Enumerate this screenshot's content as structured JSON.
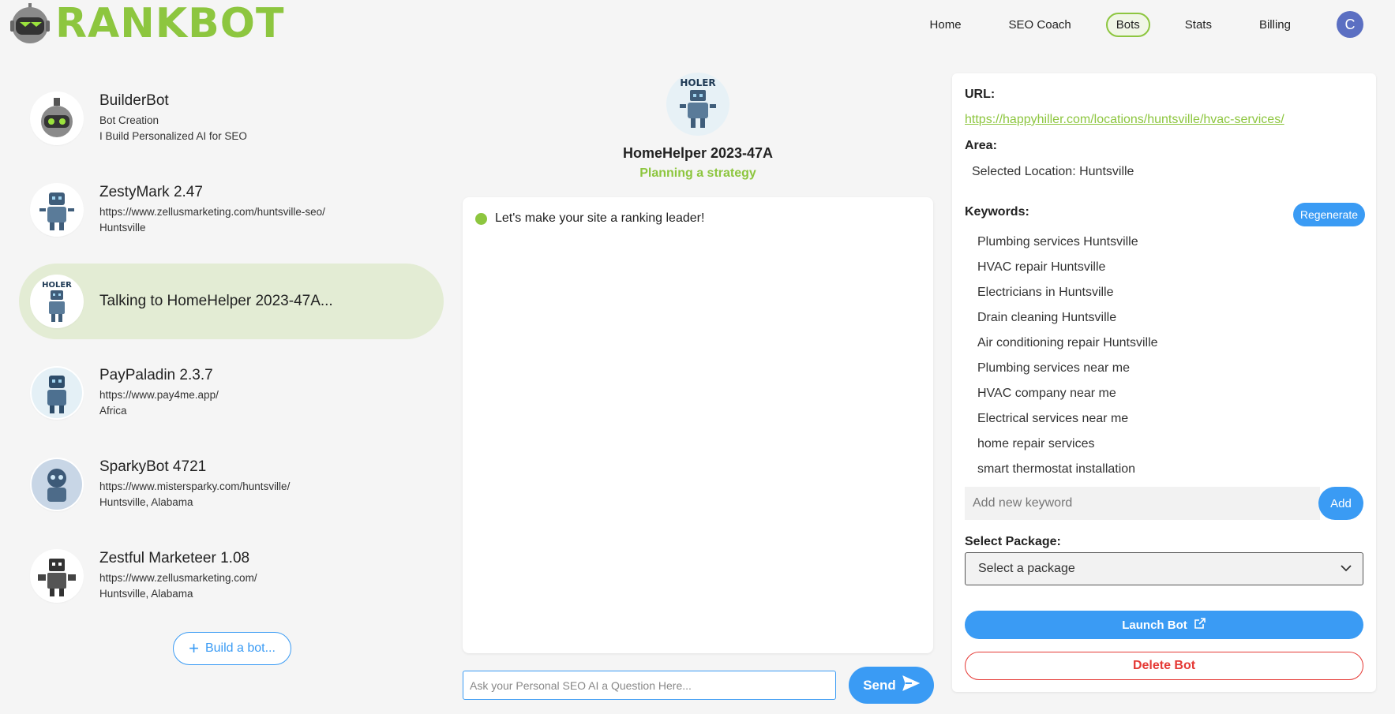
{
  "brand": {
    "name": "RANKBOT",
    "color": "#8dc63f"
  },
  "nav": {
    "items": [
      {
        "label": "Home",
        "active": false
      },
      {
        "label": "SEO Coach",
        "active": false
      },
      {
        "label": "Bots",
        "active": true
      },
      {
        "label": "Stats",
        "active": false
      },
      {
        "label": "Billing",
        "active": false
      }
    ],
    "avatar_initial": "C"
  },
  "bots": [
    {
      "name": "BuilderBot",
      "line1": "Bot Creation",
      "line2": "I Build Personalized AI for SEO",
      "icon": "builder-robot-icon"
    },
    {
      "name": "ZestyMark 2.47",
      "line1": "https://www.zellusmarketing.com/huntsville-seo/",
      "line2": "Huntsville",
      "icon": "robot-icon"
    },
    {
      "name": "Talking to HomeHelper 2023-47A...",
      "active": true,
      "icon": "homehelper-robot-icon"
    },
    {
      "name": "PayPaladin 2.3.7",
      "line1": "https://www.pay4me.app/",
      "line2": "Africa",
      "icon": "robot-icon"
    },
    {
      "name": "SparkyBot 4721",
      "line1": "https://www.mistersparky.com/huntsville/",
      "line2": "Huntsville, Alabama",
      "icon": "robot-icon"
    },
    {
      "name": "Zestful Marketeer 1.08",
      "line1": "https://www.zellusmarketing.com/",
      "line2": "Huntsville, Alabama",
      "icon": "robot-icon"
    }
  ],
  "build_button": {
    "label": "Build a bot...",
    "icon": "plus-icon"
  },
  "active_bot": {
    "name": "HomeHelper 2023-47A",
    "status": "Planning a strategy",
    "avatar_text": "HOLER"
  },
  "chat": {
    "messages": [
      {
        "text": "Let's make your site a ranking leader!"
      }
    ],
    "input_placeholder": "Ask your Personal SEO AI a Question Here...",
    "send_label": "Send"
  },
  "panel": {
    "url_label": "URL:",
    "url": "https://happyhiller.com/locations/huntsville/hvac-services/",
    "area_label": "Area:",
    "area_value": "Selected Location: Huntsville",
    "keywords_label": "Keywords:",
    "regenerate_label": "Regenerate",
    "keywords": [
      "Plumbing services Huntsville",
      "HVAC repair Huntsville",
      "Electricians in Huntsville",
      "Drain cleaning Huntsville",
      "Air conditioning repair Huntsville",
      "Plumbing services near me",
      "HVAC company near me",
      "Electrical services near me",
      "home repair services",
      "smart thermostat installation"
    ],
    "keyword_placeholder": "Add new keyword",
    "add_label": "Add",
    "package_label": "Select Package:",
    "package_value": "Select a package",
    "launch_label": "Launch Bot",
    "delete_label": "Delete Bot"
  },
  "colors": {
    "accent_blue": "#3a9bf4",
    "danger_red": "#e53935",
    "active_bg": "#e3ecd4"
  }
}
